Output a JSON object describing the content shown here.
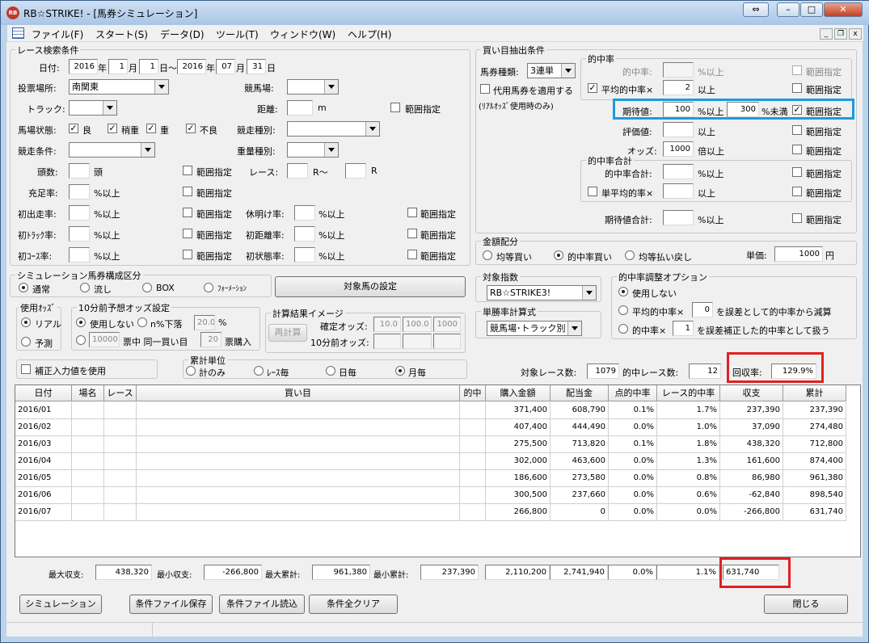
{
  "window": {
    "title": "RB☆STRIKE! - [馬券シミュレーション]",
    "app_icon": "RB"
  },
  "menu": [
    "ファイル(F)",
    "スタート(S)",
    "データ(D)",
    "ツール(T)",
    "ウィンドウ(W)",
    "ヘルプ(H)"
  ],
  "race": {
    "group": "レース検索条件",
    "date_label": "日付:",
    "y1": "2016",
    "year": "年",
    "m1": "1",
    "month": "月",
    "d1": "1",
    "day_tilde": "日〜",
    "y2": "2016",
    "m2": "07",
    "d2": "31",
    "day": "日",
    "venue_label": "投票場所:",
    "venue": "南関東",
    "course_label": "競馬場:",
    "track_label": "トラック:",
    "distance_label": "距離:",
    "distance_unit": "m",
    "range": "範囲指定",
    "cond_label": "馬場状態:",
    "cond": [
      "良",
      "稍重",
      "重",
      "不良"
    ],
    "kind_label": "競走種別:",
    "cond2_label": "競走条件:",
    "weight_label": "重量種別:",
    "heads_label": "頭数:",
    "heads_unit": "頭",
    "race_label": "レース:",
    "r_tilde": "R〜",
    "r": "R",
    "fill_label": "充足率:",
    "pct_over": "%以上",
    "first_label": "初出走率:",
    "rest_label": "休明け率:",
    "ftrack_label": "初ﾄﾗｯｸ率:",
    "fdist_label": "初距離率:",
    "fcourse_label": "初ｺｰｽ率:",
    "fstate_label": "初状態率:"
  },
  "buy": {
    "group": "買い目抽出条件",
    "type_label": "馬券種類:",
    "type": "3連単",
    "subst": "代用馬券を適用する",
    "real_note": "(ﾘｱﾙｵｯｽﾞ使用時のみ)",
    "hit_group": "的中率",
    "hit_label": "的中率:",
    "pct_over": "%以上",
    "avg_hit": "平均的中率×",
    "avg_val": "2",
    "over": "以上",
    "range": "範囲指定",
    "ev_label": "期待値:",
    "ev_val": "100",
    "ev_max": "300",
    "under": "%未満",
    "score_label": "評価値:",
    "odds_label": "オッズ:",
    "odds_val": "1000",
    "odds_unit": "倍以上",
    "sum_group": "的中率合計",
    "sum_label": "的中率合計:",
    "single_avg": "単平均的率×",
    "ev_sum": "期待値合計:"
  },
  "money": {
    "group": "金額配分",
    "opts": [
      "均等買い",
      "的中率買い",
      "均等払い戻し"
    ],
    "unit_label": "単価:",
    "unit": "1000",
    "yen": "円"
  },
  "sim": {
    "group": "シミュレーション馬券構成区分",
    "opts": [
      "通常",
      "流し",
      "BOX",
      "ﾌｫｰﾒｰｼｮﾝ"
    ],
    "set_btn": "対象馬の設定"
  },
  "odds_use": {
    "group": "使用ｵｯｽﾞ",
    "opts": [
      "リアル",
      "予測"
    ]
  },
  "pre": {
    "group": "10分前予想オッズ設定",
    "no_use": "使用しない",
    "drop": "n%下落",
    "drop_val": "20.0",
    "pct": "%",
    "v1": "10000",
    "mid": "票中 同一買い目",
    "v2": "20",
    "buy": "票購入"
  },
  "calc": {
    "group": "計算結果イメージ",
    "btn": "再計算",
    "fixed": "確定オッズ:",
    "f1": "10.0",
    "f2": "100.0",
    "f3": "1000",
    "pre10": "10分前オッズ:"
  },
  "target": {
    "group": "対象指数",
    "value": "RB☆STRIKE3!"
  },
  "single": {
    "group": "単勝率計算式",
    "value": "競馬場･トラック別"
  },
  "adjust": {
    "group": "的中率調整オプション",
    "opt1": "使用しない",
    "opt2a": "平均的中率×",
    "opt2v": "0",
    "opt2b": "を誤差として的中率から減算",
    "opt3a": "的中率×",
    "opt3v": "1",
    "opt3b": "を誤差補正した的中率として扱う"
  },
  "corr": "補正入力値を使用",
  "unitg": {
    "group": "累計単位",
    "opts": [
      "計のみ",
      "ﾚｰｽ毎",
      "日毎",
      "月毎"
    ]
  },
  "summary": {
    "races_label": "対象レース数:",
    "races": "1079",
    "hits_label": "的中レース数:",
    "hits": "12",
    "rr_label": "回収率:",
    "rr": "129.9%"
  },
  "grid": {
    "headers": [
      "日付",
      "場名",
      "レース",
      "買い目",
      "的中",
      "購入金額",
      "配当金",
      "点的中率",
      "レース的中率",
      "収支",
      "累計"
    ],
    "rows": [
      [
        "2016/01",
        "",
        "",
        "",
        "",
        "371,400",
        "608,790",
        "0.1%",
        "1.7%",
        "237,390",
        "237,390"
      ],
      [
        "2016/02",
        "",
        "",
        "",
        "",
        "407,400",
        "444,490",
        "0.0%",
        "1.0%",
        "37,090",
        "274,480"
      ],
      [
        "2016/03",
        "",
        "",
        "",
        "",
        "275,500",
        "713,820",
        "0.1%",
        "1.8%",
        "438,320",
        "712,800"
      ],
      [
        "2016/04",
        "",
        "",
        "",
        "",
        "302,000",
        "463,600",
        "0.0%",
        "1.3%",
        "161,600",
        "874,400"
      ],
      [
        "2016/05",
        "",
        "",
        "",
        "",
        "186,600",
        "273,580",
        "0.0%",
        "0.8%",
        "86,980",
        "961,380"
      ],
      [
        "2016/06",
        "",
        "",
        "",
        "",
        "300,500",
        "237,660",
        "0.0%",
        "0.6%",
        "-62,840",
        "898,540"
      ],
      [
        "2016/07",
        "",
        "",
        "",
        "",
        "266,800",
        "0",
        "0.0%",
        "0.0%",
        "-266,800",
        "631,740"
      ]
    ]
  },
  "totals": {
    "max_label": "最大収支:",
    "max": "438,320",
    "min_label": "最小収支:",
    "min": "-266,800",
    "maxc_label": "最大累計:",
    "maxc": "961,380",
    "minc_label": "最小累計:",
    "minc": "237,390",
    "buy": "2,110,200",
    "pay": "2,741,940",
    "pt": "0.0%",
    "rt": "1.1%",
    "cum": "631,740"
  },
  "buttons": {
    "simulate": "シミュレーション",
    "save": "条件ファイル保存",
    "load": "条件ファイル読込",
    "clear": "条件全クリア",
    "close": "閉じる"
  },
  "colors": {
    "highlight_red": "#e02020",
    "highlight_blue": "#1a9be0"
  }
}
